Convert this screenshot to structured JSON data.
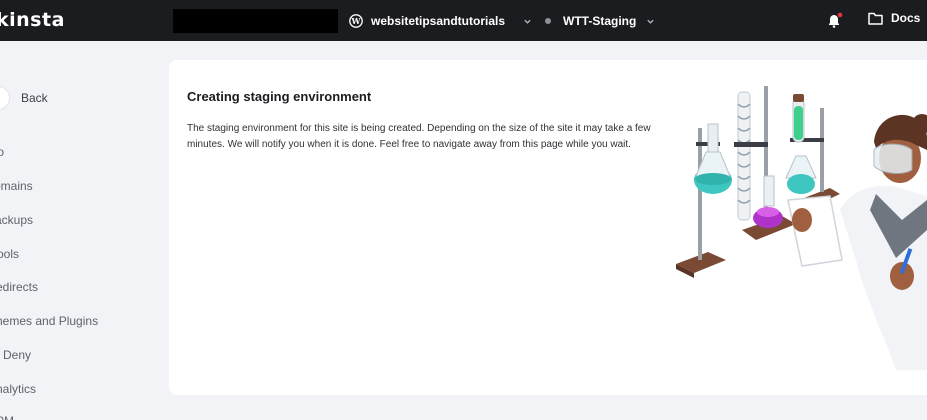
{
  "header": {
    "logo_text": "kinsta",
    "site_name": "websitetipsandtutorials",
    "environment_name": "WTT-Staging",
    "docs_label": "Docs",
    "notification_color": "#e5343d"
  },
  "sidebar": {
    "back_label": "Back",
    "items": [
      {
        "label": "fo"
      },
      {
        "label": "omains"
      },
      {
        "label": "ackups"
      },
      {
        "label": "ools"
      },
      {
        "label": "edirects"
      },
      {
        "label": "hemes and Plugins"
      },
      {
        "label": "Deny"
      },
      {
        "label": "nalytics"
      },
      {
        "label": "PM"
      }
    ]
  },
  "main": {
    "title": "Creating staging environment",
    "message": "The staging environment for this site is being created. Depending on the size of the site it may take a few minutes. We will notify you when it is done. Feel free to navigate away from this page while you wait."
  },
  "icons": [
    "wordpress-icon",
    "chevron-down-icon",
    "bell-icon",
    "folder-icon",
    "back-arrow-icon"
  ]
}
